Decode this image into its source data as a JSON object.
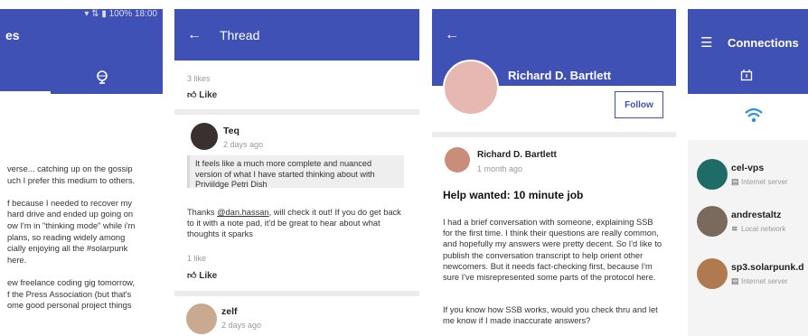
{
  "panel1": {
    "status": "100% 18:00",
    "title": "es",
    "lines": [
      "verse... catching up on the gossip",
      "uch I prefer this medium to others.",
      "",
      "f because I needed to recover my",
      "hard drive and ended up going on",
      "ow I'm in \"thinking mode\" while i'm",
      "plans, so reading widely among",
      "cially enjoying all the #solarpunk",
      "here.",
      "",
      "ew freelance coding gig tomorrow,",
      "f the Press Association (but that's",
      "ome good personal project things"
    ]
  },
  "thread": {
    "title": "Thread",
    "likes_top": "3 likes",
    "like_label": "Like",
    "post1": {
      "author": "Teq",
      "time": "2 days ago",
      "quote": "It feels like a much more complete and nuanced version of what I have started thinking about with Priviildge Petri Dish",
      "body_prefix": "Thanks ",
      "mention": "@dan.hassan",
      "body_rest": ", will check it out! If you do get back to it with a note pad, it'd be great to hear about what thoughts it sparks",
      "likes": "1 like"
    },
    "post2": {
      "author": "zelf",
      "time": "2 days ago"
    }
  },
  "profile": {
    "name": "Richard D. Bartlett",
    "follow": "Follow",
    "post": {
      "author": "Richard D. Bartlett",
      "time": "1 month ago",
      "heading": "Help wanted: 10 minute job",
      "para1": "I had a brief conversation with someone, explaining SSB for the first time. I think their questions are really common, and hopefully my answers were pretty decent. So I'd like to publish the conversation transcript to help orient other newcomers. But it needs fact-checking first, because I'm sure I've misrepresented some parts of the protocol here.",
      "para2": "If you know how SSB works, would you check thru and let me know if I made inaccurate answers?"
    }
  },
  "connections": {
    "title": "Connections",
    "items": [
      {
        "name": "cel-vps",
        "sub": "Internet server",
        "icon": "server-icon"
      },
      {
        "name": "andrestaltz",
        "sub": "Local network",
        "icon": "wifi-icon"
      },
      {
        "name": "sp3.solarpunk.d",
        "sub": "Internet server",
        "icon": "server-icon"
      }
    ]
  },
  "colors": {
    "appbar": "#3f51b5",
    "accent": "#3f51b5"
  }
}
